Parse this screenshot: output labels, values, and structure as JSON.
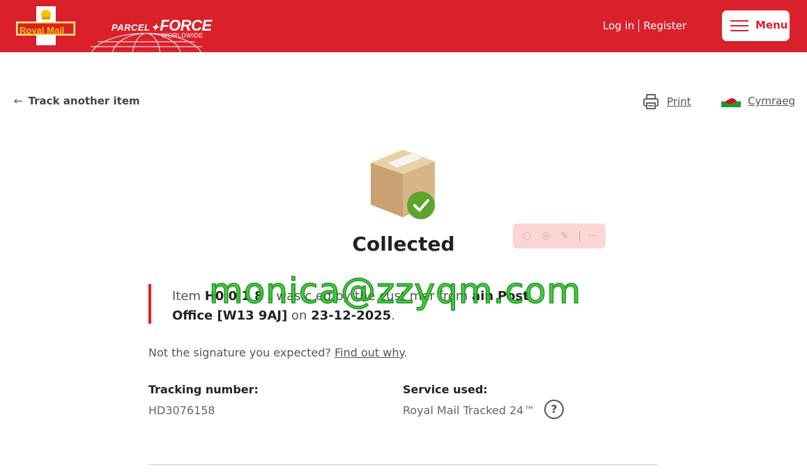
{
  "header": {
    "royal_mail_logo": "Royal Mail",
    "parcelforce_parcel": "PARCEL",
    "parcelforce_force": "FORCE",
    "parcelforce_worldwide": "WORLDWIDE",
    "login": "Log in",
    "register": "Register",
    "menu": "Menu"
  },
  "nav": {
    "track_another": "Track another item",
    "print": "Print",
    "language": "Cymraeg"
  },
  "status": {
    "title": "Collected"
  },
  "message": {
    "item_prefix": "Item",
    "item_code": "H0 0 1 8 .",
    "middle_text": "was c  ed by the cust mer from",
    "location_partial": "  ain",
    "location_a": "Post",
    "location_b": "Office [W13 9AJ]",
    "on": "on",
    "date": "23-12-2025",
    "end": "."
  },
  "watermark": "monica@zzyqm.com",
  "signature_note": {
    "text": "Not the signature you expected?",
    "link": "Find out why",
    "end": "."
  },
  "details": {
    "tracking_label": "Tracking number:",
    "tracking_value": "HD3076158",
    "service_label": "Service used:",
    "service_value": "Royal Mail Tracked 24™",
    "help": "?"
  },
  "colors": {
    "brand_red": "#da202a",
    "tick_green": "#5aa52b"
  }
}
